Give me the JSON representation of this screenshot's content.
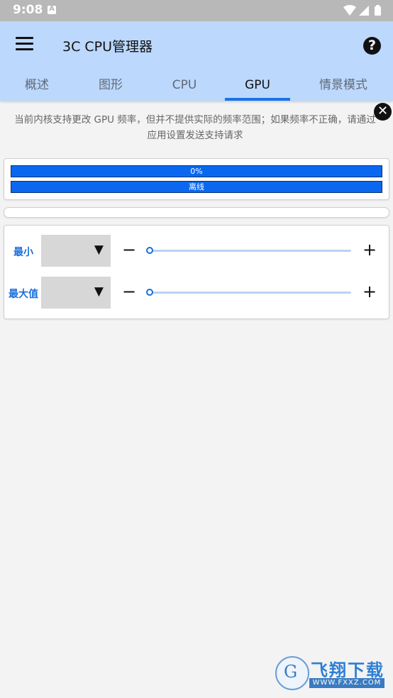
{
  "status_bar": {
    "time": "9:08",
    "notification_letter": "A"
  },
  "app_bar": {
    "title": "3C CPU管理器",
    "help_glyph": "?"
  },
  "tabs": [
    {
      "label": "概述"
    },
    {
      "label": "图形"
    },
    {
      "label": "CPU"
    },
    {
      "label": "GPU",
      "active": true
    },
    {
      "label": "情景模式"
    }
  ],
  "notice": {
    "text": "当前内核支持更改 GPU 频率，但并不提供实际的频率范围；如果频率不正确，请通过应用设置发送支持请求",
    "close_glyph": "✕"
  },
  "status_card": {
    "load_text": "0%",
    "state_text": "离线"
  },
  "freq_controls": {
    "min_label": "最小",
    "max_label": "最大值",
    "dropdown_arrow": "▼",
    "minus_glyph": "−",
    "plus_glyph": "+",
    "min_slider_fraction": 0,
    "max_slider_fraction": 0
  },
  "watermark": {
    "logo_char": "G",
    "text": "飞翔下载",
    "url": "WWW.FXXZ.COM"
  },
  "colors": {
    "accent": "#1a73e8",
    "app_bar": "#bcd8fd",
    "bar_fill": "#0a68f0",
    "label": "#1a6fd8"
  }
}
